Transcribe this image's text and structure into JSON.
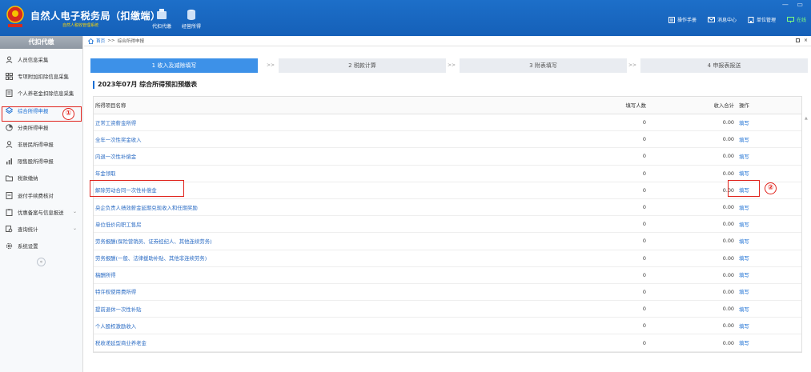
{
  "header": {
    "app_title": "自然人电子税务局（扣缴端）",
    "app_subtitle": "自然人税收管理系统",
    "nav": [
      {
        "label": "代扣代缴"
      },
      {
        "label": "经营所得"
      }
    ],
    "right": [
      {
        "label": "操作手册"
      },
      {
        "label": "消息中心"
      },
      {
        "label": "单位管理"
      },
      {
        "label": "在线"
      }
    ],
    "window_controls": "— ▭"
  },
  "sidebar": {
    "title": "代扣代缴",
    "items": [
      {
        "label": "人员信息采集",
        "icon": "person-icon"
      },
      {
        "label": "专项附加扣除信息采集",
        "icon": "grid-icon"
      },
      {
        "label": "个人养老金扣除信息采集",
        "icon": "document-icon"
      },
      {
        "label": "综合所得申报",
        "icon": "layers-icon"
      },
      {
        "label": "分类所得申报",
        "icon": "pie-icon"
      },
      {
        "label": "非居民所得申报",
        "icon": "user-icon"
      },
      {
        "label": "限售股所得申报",
        "icon": "bar-chart-icon"
      },
      {
        "label": "税款缴纳",
        "icon": "folder-icon"
      },
      {
        "label": "退付手续费核对",
        "icon": "receipt-icon"
      },
      {
        "label": "优惠备案与信息报送",
        "icon": "clipboard-icon"
      },
      {
        "label": "查询统计",
        "icon": "search-list-icon"
      },
      {
        "label": "系统设置",
        "icon": "gear-icon"
      }
    ],
    "collapse": "«"
  },
  "main": {
    "breadcrumb": {
      "home": "首页",
      "separator": ">>",
      "current": "综合所得申报"
    },
    "steps": [
      {
        "label": "1 收入及减除填写"
      },
      {
        "label": "2 税款计算"
      },
      {
        "label": "3 附表填写"
      },
      {
        "label": "4 申报表报送"
      }
    ],
    "step_arrow": ">>",
    "page_title": "2023年07月  综合所得预扣预缴表",
    "table": {
      "headers": [
        "所得项目名称",
        "填写人数",
        "收入合计",
        "操作"
      ],
      "rows": [
        {
          "name": "正常工资薪金所得",
          "count": "0",
          "income": "0.00",
          "action": "填写"
        },
        {
          "name": "全年一次性奖金收入",
          "count": "0",
          "income": "0.00",
          "action": "填写"
        },
        {
          "name": "内退一次性补偿金",
          "count": "0",
          "income": "0.00",
          "action": "填写"
        },
        {
          "name": "年金领取",
          "count": "0",
          "income": "0.00",
          "action": "填写"
        },
        {
          "name": "解除劳动合同一次性补偿金",
          "count": "0",
          "income": "0.00",
          "action": "填写"
        },
        {
          "name": "央企负责人绩效薪金延期兑现收入和任期奖励",
          "count": "0",
          "income": "0.00",
          "action": "填写"
        },
        {
          "name": "单位低价向职工售房",
          "count": "0",
          "income": "0.00",
          "action": "填写"
        },
        {
          "name": "劳务报酬(保险营销员、证券经纪人、其他连续劳务)",
          "count": "0",
          "income": "0.00",
          "action": "填写"
        },
        {
          "name": "劳务报酬(一般、法律援助补贴、其他非连续劳务)",
          "count": "0",
          "income": "0.00",
          "action": "填写"
        },
        {
          "name": "稿酬所得",
          "count": "0",
          "income": "0.00",
          "action": "填写"
        },
        {
          "name": "特许权使用费所得",
          "count": "0",
          "income": "0.00",
          "action": "填写"
        },
        {
          "name": "提前退休一次性补贴",
          "count": "0",
          "income": "0.00",
          "action": "填写"
        },
        {
          "name": "个人股权激励收入",
          "count": "0",
          "income": "0.00",
          "action": "填写"
        },
        {
          "name": "税收递延型商业养老金",
          "count": "0",
          "income": "0.00",
          "action": "填写"
        }
      ]
    }
  },
  "annotations": {
    "badge1": "①",
    "badge2": "②"
  },
  "colors": {
    "header_blue": "#1660b8",
    "accent": "#3d91e8",
    "link": "#2b6cc4",
    "highlight_red": "#e0231c"
  }
}
